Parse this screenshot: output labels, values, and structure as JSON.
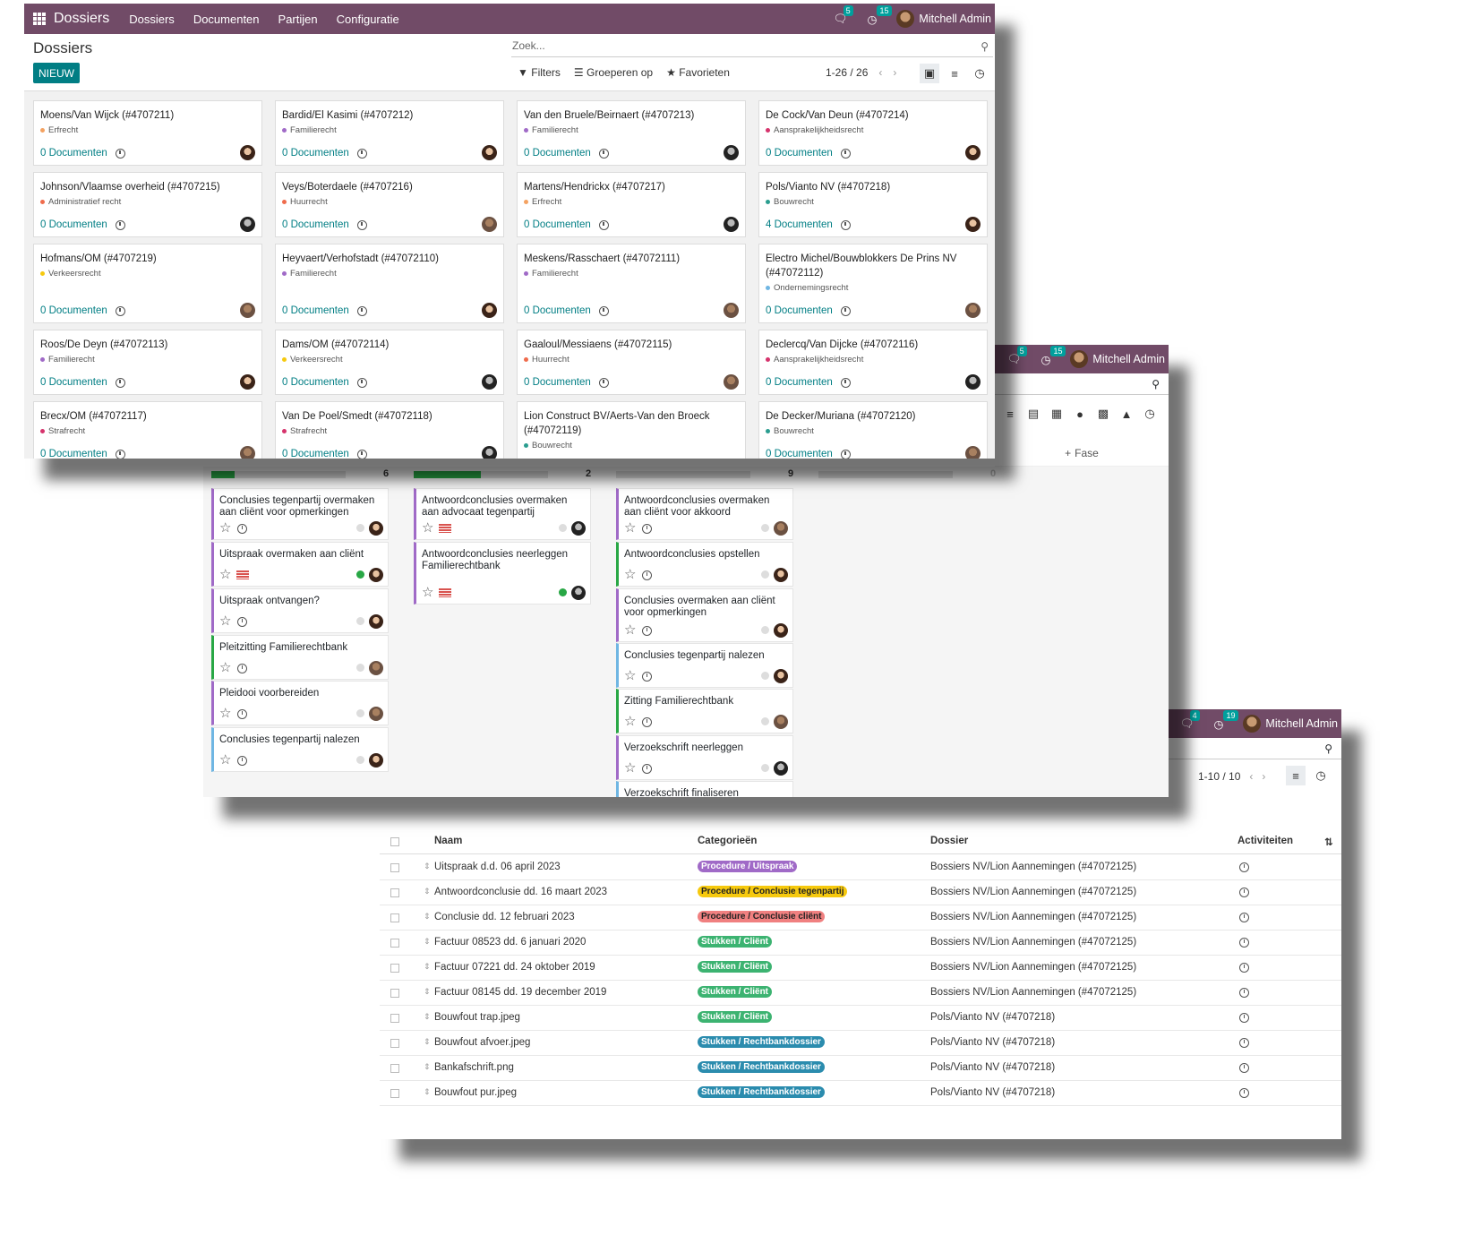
{
  "w1": {
    "brand": "Dossiers",
    "menus": [
      "Dossiers",
      "Documenten",
      "Partijen",
      "Configuratie"
    ],
    "msg_count": "5",
    "act_count": "15",
    "user": "Mitchell Admin",
    "title": "Dossiers",
    "new_btn": "NIEUW",
    "search_placeholder": "Zoek...",
    "filters": "Filters",
    "groupby": "Groeperen op",
    "favorites": "Favorieten",
    "pager": "1-26 / 26",
    "cards": [
      {
        "title": "Moens/Van Wijck (#4707211)",
        "tag": "Erfrecht",
        "tagcolor": "#f4a261",
        "docs": "0 Documenten"
      },
      {
        "title": "Bardid/El Kasimi (#4707212)",
        "tag": "Familierecht",
        "tagcolor": "#a06ac7",
        "docs": "0 Documenten"
      },
      {
        "title": "Van den Bruele/Beirnaert (#4707213)",
        "tag": "Familierecht",
        "tagcolor": "#a06ac7",
        "docs": "0 Documenten"
      },
      {
        "title": "De Cock/Van Deun (#4707214)",
        "tag": "Aansprakelijkheidsrecht",
        "tagcolor": "#d6336c",
        "docs": "0 Documenten"
      },
      {
        "title": "Johnson/Vlaamse overheid (#4707215)",
        "tag": "Administratief recht",
        "tagcolor": "#ef6b4c",
        "docs": "0 Documenten"
      },
      {
        "title": "Veys/Boterdaele (#4707216)",
        "tag": "Huurrecht",
        "tagcolor": "#ef6b4c",
        "docs": "0 Documenten"
      },
      {
        "title": "Martens/Hendrickx (#4707217)",
        "tag": "Erfrecht",
        "tagcolor": "#f4a261",
        "docs": "0 Documenten"
      },
      {
        "title": "Pols/Vianto NV (#4707218)",
        "tag": "Bouwrecht",
        "tagcolor": "#2a9d8f",
        "docs": "4 Documenten"
      },
      {
        "title": "Hofmans/OM (#4707219)",
        "tag": "Verkeersrecht",
        "tagcolor": "#f6c90e",
        "docs": "0 Documenten"
      },
      {
        "title": "Heyvaert/Verhofstadt (#47072110)",
        "tag": "Familierecht",
        "tagcolor": "#a06ac7",
        "docs": "0 Documenten"
      },
      {
        "title": "Meskens/Rasschaert (#47072111)",
        "tag": "Familierecht",
        "tagcolor": "#a06ac7",
        "docs": "0 Documenten"
      },
      {
        "title": "Electro Michel/Bouwblokkers De Prins NV (#47072112)",
        "tag": "Ondernemingsrecht",
        "tagcolor": "#6fb6e3",
        "docs": "0 Documenten"
      },
      {
        "title": "Roos/De Deyn (#47072113)",
        "tag": "Familierecht",
        "tagcolor": "#a06ac7",
        "docs": "0 Documenten"
      },
      {
        "title": "Dams/OM (#47072114)",
        "tag": "Verkeersrecht",
        "tagcolor": "#f6c90e",
        "docs": "0 Documenten"
      },
      {
        "title": "Gaaloul/Messiaens (#47072115)",
        "tag": "Huurrecht",
        "tagcolor": "#ef6b4c",
        "docs": "0 Documenten"
      },
      {
        "title": "Declercq/Van Dijcke (#47072116)",
        "tag": "Aansprakelijkheidsrecht",
        "tagcolor": "#d6336c",
        "docs": "0 Documenten"
      },
      {
        "title": "Brecx/OM (#47072117)",
        "tag": "Strafrecht",
        "tagcolor": "#d6336c",
        "docs": "0 Documenten"
      },
      {
        "title": "Van De Poel/Smedt (#47072118)",
        "tag": "Strafrecht",
        "tagcolor": "#d6336c",
        "docs": "0 Documenten"
      },
      {
        "title": "Lion Construct BV/Aerts-Van den Broeck (#47072119)",
        "tag": "Bouwrecht",
        "tagcolor": "#2a9d8f",
        "docs": ""
      },
      {
        "title": "De Decker/Muriana (#47072120)",
        "tag": "Bouwrecht",
        "tagcolor": "#2a9d8f",
        "docs": "0 Documenten"
      }
    ]
  },
  "w2": {
    "msg_count": "5",
    "act_count": "15",
    "user": "Mitchell Admin",
    "add_stage": "Fase",
    "columns": [
      {
        "count": "6",
        "progress": 0.17,
        "cards": [
          {
            "title": "Conclusies tegenpartij overmaken aan cliënt voor opmerkingen",
            "color": "",
            "flag": false,
            "state": false
          },
          {
            "title": "Uitspraak overmaken aan cliënt",
            "color": "",
            "flag": true,
            "state": true
          },
          {
            "title": "Uitspraak ontvangen?",
            "color": "",
            "flag": false,
            "state": false
          },
          {
            "title": "Pleitzitting Familierechtbank",
            "color": "green",
            "flag": false,
            "state": false
          },
          {
            "title": "Pleidooi voorbereiden",
            "color": "",
            "flag": false,
            "state": false
          },
          {
            "title": "Conclusies tegenpartij nalezen",
            "color": "blue",
            "flag": false,
            "state": false
          }
        ]
      },
      {
        "count": "2",
        "progress": 0.5,
        "cards": [
          {
            "title": "Antwoordconclusies overmaken aan advocaat tegenpartij",
            "color": "",
            "flag": true,
            "state": false
          },
          {
            "title": "Antwoordconclusies neerleggen Familierechtbank",
            "color": "",
            "flag": true,
            "state": true
          }
        ]
      },
      {
        "count": "9",
        "progress": 0,
        "cards": [
          {
            "title": "Antwoordconclusies overmaken aan cliënt voor akkoord",
            "color": "",
            "flag": false,
            "state": false
          },
          {
            "title": "Antwoordconclusies opstellen",
            "color": "green",
            "flag": false,
            "state": false
          },
          {
            "title": "Conclusies overmaken aan cliënt voor opmerkingen",
            "color": "",
            "flag": false,
            "state": false
          },
          {
            "title": "Conclusies tegenpartij nalezen",
            "color": "blue",
            "flag": false,
            "state": false
          },
          {
            "title": "Zitting Familierechtbank",
            "color": "green",
            "flag": false,
            "state": false
          },
          {
            "title": "Verzoekschrift neerleggen",
            "color": "",
            "flag": false,
            "state": false
          },
          {
            "title": "Verzoekschrift finaliseren",
            "color": "blue",
            "flag": false,
            "state": false
          }
        ]
      },
      {
        "count": "0",
        "progress": 0,
        "cards": []
      }
    ]
  },
  "w3": {
    "msg_count": "4",
    "act_count": "19",
    "user": "Mitchell Admin",
    "pager": "1-10 / 10",
    "headers": {
      "name": "Naam",
      "categories": "Categorieën",
      "dossier": "Dossier",
      "activities": "Activiteiten"
    },
    "rows": [
      {
        "name": "Uitspraak d.d. 06 april 2023",
        "cat": "Procedure / Uitspraak",
        "bg": "#a06ac7",
        "fg": "#ffffff",
        "dossier": "Bossiers NV/Lion Aannemingen (#47072125)"
      },
      {
        "name": "Antwoordconclusie dd. 16 maart 2023",
        "cat": "Procedure / Conclusie tegenpartij",
        "bg": "#f6c90e",
        "fg": "#222222",
        "dossier": "Bossiers NV/Lion Aannemingen (#47072125)"
      },
      {
        "name": "Conclusie dd. 12 februari 2023",
        "cat": "Procedure / Conclusie cliënt",
        "bg": "#f08080",
        "fg": "#222222",
        "dossier": "Bossiers NV/Lion Aannemingen (#47072125)"
      },
      {
        "name": "Factuur 08523 dd. 6 januari 2020",
        "cat": "Stukken / Cliënt",
        "bg": "#3cb371",
        "fg": "#ffffff",
        "dossier": "Bossiers NV/Lion Aannemingen (#47072125)"
      },
      {
        "name": "Factuur 07221 dd. 24 oktober 2019",
        "cat": "Stukken / Cliënt",
        "bg": "#3cb371",
        "fg": "#ffffff",
        "dossier": "Bossiers NV/Lion Aannemingen (#47072125)"
      },
      {
        "name": "Factuur 08145 dd. 19 december 2019",
        "cat": "Stukken / Cliënt",
        "bg": "#3cb371",
        "fg": "#ffffff",
        "dossier": "Bossiers NV/Lion Aannemingen (#47072125)"
      },
      {
        "name": "Bouwfout trap.jpeg",
        "cat": "Stukken / Cliënt",
        "bg": "#3cb371",
        "fg": "#ffffff",
        "dossier": "Pols/Vianto NV (#4707218)"
      },
      {
        "name": "Bouwfout afvoer.jpeg",
        "cat": "Stukken / Rechtbankdossier",
        "bg": "#2b8cae",
        "fg": "#ffffff",
        "dossier": "Pols/Vianto NV (#4707218)"
      },
      {
        "name": "Bankafschrift.png",
        "cat": "Stukken / Rechtbankdossier",
        "bg": "#2b8cae",
        "fg": "#ffffff",
        "dossier": "Pols/Vianto NV (#4707218)"
      },
      {
        "name": "Bouwfout pur.jpeg",
        "cat": "Stukken / Rechtbankdossier",
        "bg": "#2b8cae",
        "fg": "#ffffff",
        "dossier": "Pols/Vianto NV (#4707218)"
      }
    ]
  }
}
